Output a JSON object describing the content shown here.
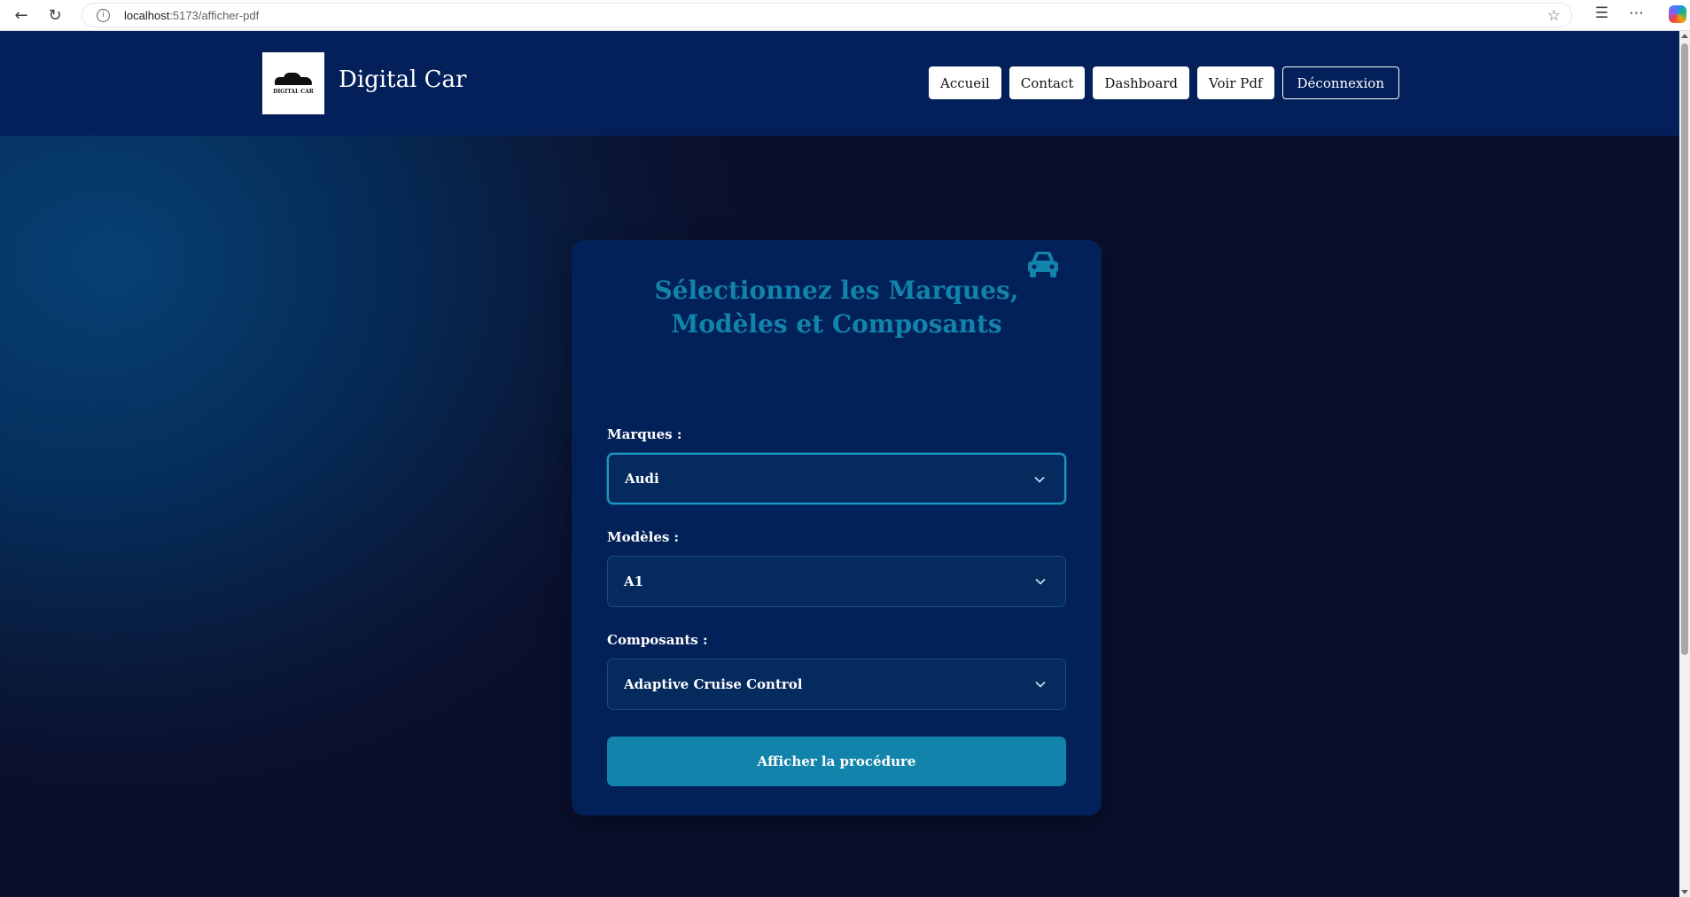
{
  "browser": {
    "url_host": "localhost",
    "url_path": ":5173/afficher-pdf"
  },
  "header": {
    "logo_text": "DIGITAL CAR",
    "site_title": "Digital Car",
    "nav": [
      {
        "label": "Accueil"
      },
      {
        "label": "Contact"
      },
      {
        "label": "Dashboard"
      },
      {
        "label": "Voir Pdf"
      },
      {
        "label": "Déconnexion"
      }
    ]
  },
  "form": {
    "title": "Sélectionnez les Marques, Modèles et Composants",
    "marques_label": "Marques :",
    "marques_value": "Audi",
    "modeles_label": "Modèles :",
    "modeles_value": "A1",
    "composants_label": "Composants :",
    "composants_value": "Adaptive Cruise Control",
    "submit_label": "Afficher la procédure"
  },
  "colors": {
    "header_bg": "#03205a",
    "card_bg": "#032159",
    "accent": "#1283aa"
  }
}
